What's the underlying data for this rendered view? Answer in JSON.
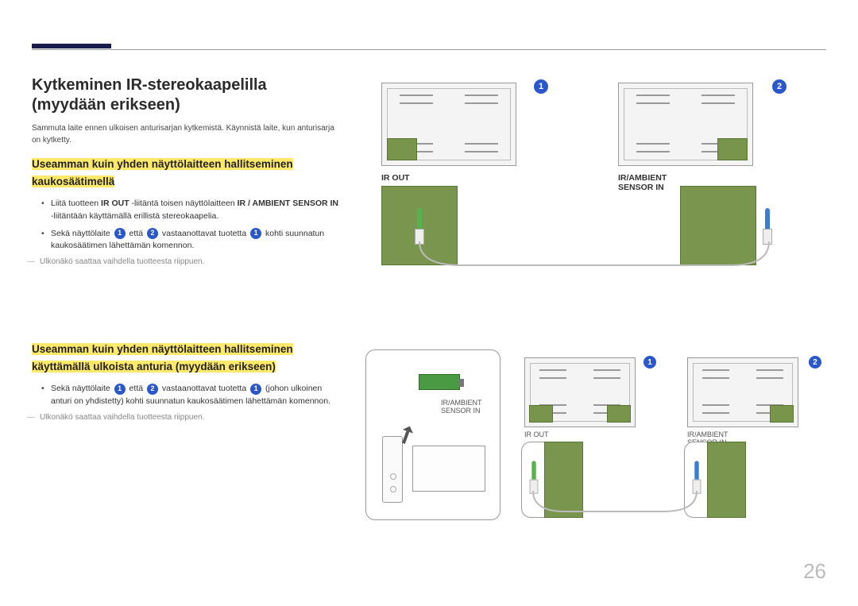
{
  "page_number": "26",
  "title": "Kytkeminen IR-stereokaapelilla (myydään erikseen)",
  "intro": "Sammuta laite ennen ulkoisen anturisarjan kytkemistä. Käynnistä laite, kun anturisarja on kytketty.",
  "section1": {
    "heading": "Useamman kuin yhden näyttölaitteen hallitseminen kaukosäätimellä",
    "bullet1_pre": "Liitä tuotteen ",
    "bullet1_bold1": "IR OUT",
    "bullet1_mid": " -liitäntä toisen näyttölaitteen ",
    "bullet1_bold2": "IR / AMBIENT SENSOR IN",
    "bullet1_post": " -liitäntään käyttämällä erillistä stereokaapelia.",
    "bullet2_pre": "Sekä näyttölaite ",
    "bullet2_mid1": " että ",
    "bullet2_mid2": " vastaanottavat tuotetta ",
    "bullet2_post": " kohti suunnatun kaukosäätimen lähettämän komennon.",
    "note": "Ulkonäkö saattaa vaihdella tuotteesta riippuen."
  },
  "section2": {
    "heading": "Useamman kuin yhden näyttölaitteen hallitseminen käyttämällä ulkoista anturia (myydään erikseen)",
    "bullet_pre": "Sekä näyttölaite ",
    "bullet_mid1": " että ",
    "bullet_mid2": " vastaanottavat tuotetta ",
    "bullet_post": " (johon ulkoinen anturi on yhdistetty) kohti suunnatun kaukosäätimen lähettämän komennon.",
    "note": "Ulkonäkö saattaa vaihdella tuotteesta riippuen."
  },
  "labels": {
    "ir_out": "IR OUT",
    "ir_ambient": "IR/AMBIENT",
    "sensor_in": "SENSOR IN",
    "num1": "1",
    "num2": "2"
  }
}
